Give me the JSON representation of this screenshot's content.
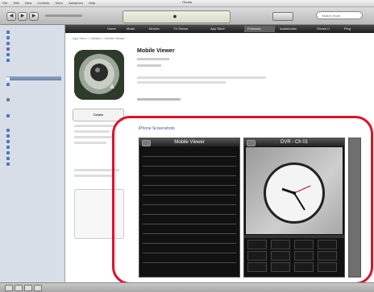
{
  "window": {
    "title": "iTunes"
  },
  "menubar": [
    "File",
    "Edit",
    "View",
    "Controls",
    "Store",
    "Advanced",
    "Help"
  ],
  "search": {
    "placeholder": "Search Store"
  },
  "store_nav": {
    "tabs": [
      "Home",
      "Music",
      "Movies",
      "TV Shows",
      "App Store",
      "Podcasts",
      "Audiobooks",
      "iTunes U",
      "Ping"
    ],
    "selected": "App Store"
  },
  "breadcrumb": "App Store > Utilities > Mobile Viewer",
  "app": {
    "title": "Mobile Viewer",
    "details_label": "Details",
    "screenshots_label": "iPhone Screenshots"
  },
  "screenshots": [
    {
      "title": "Mobile Viewer"
    },
    {
      "title": "DVR - Ch 01"
    }
  ],
  "colors": {
    "highlight": "#e0102a",
    "navbar": "#2b2b2b",
    "sidebar": "#d8dee7"
  }
}
